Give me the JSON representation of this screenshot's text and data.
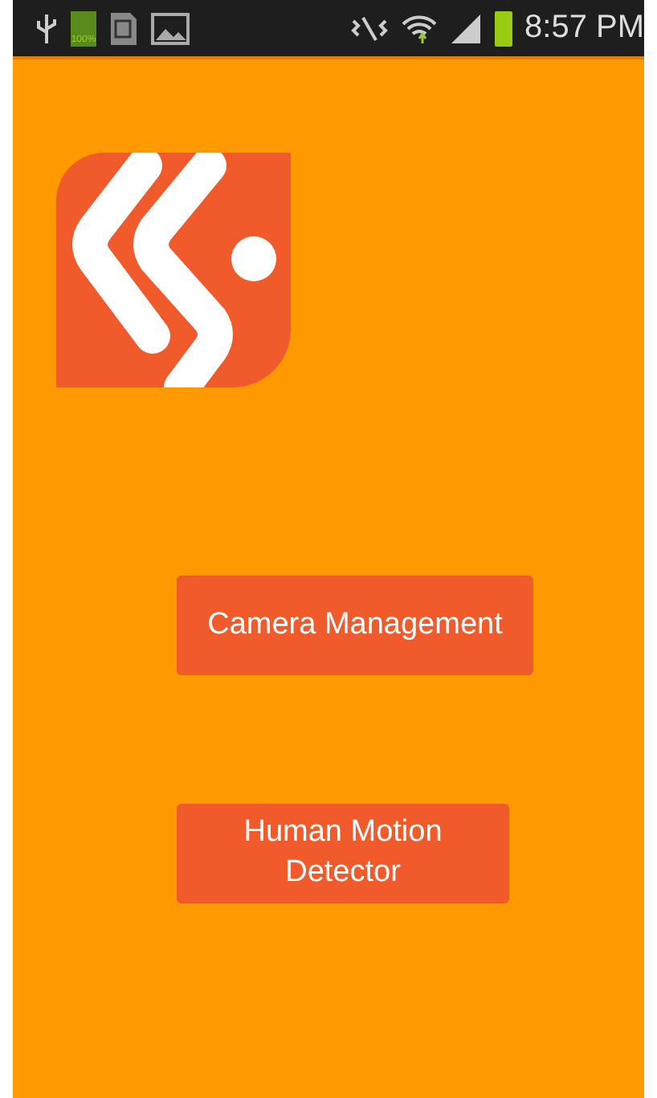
{
  "status_bar": {
    "battery_label": "100%",
    "time": "8:57 PM"
  },
  "buttons": [
    {
      "label": "Camera Management"
    },
    {
      "label": "Human Motion\nDetector"
    }
  ]
}
